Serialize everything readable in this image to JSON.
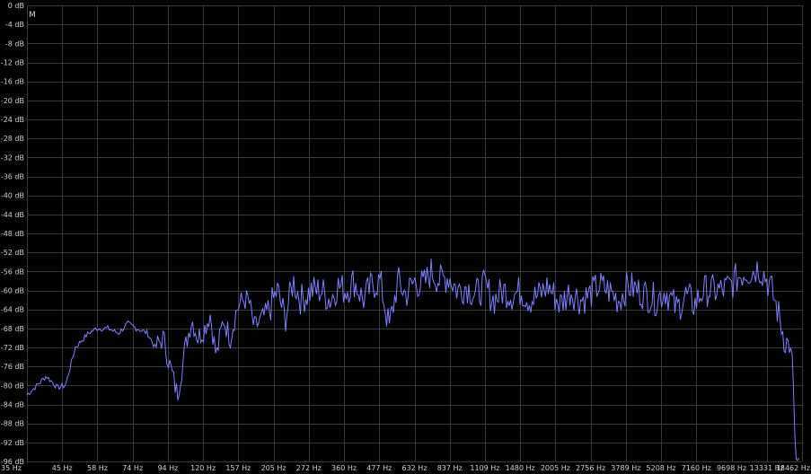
{
  "mode_label": "M",
  "colors": {
    "background": "#000000",
    "grid": "#3a3a3a",
    "text": "#cfcfcf",
    "trace": "#8080ff"
  },
  "chart_data": {
    "type": "line",
    "xscale": "log",
    "xlim": [
      35,
      20000
    ],
    "ylim": [
      -96,
      0
    ],
    "grid": true,
    "y_ticks": [
      "0 dB",
      "-4 dB",
      "-8 dB",
      "-12 dB",
      "-16 dB",
      "-20 dB",
      "-24 dB",
      "-28 dB",
      "-32 dB",
      "-36 dB",
      "-40 dB",
      "-44 dB",
      "-48 dB",
      "-52 dB",
      "-56 dB",
      "-60 dB",
      "-64 dB",
      "-68 dB",
      "-72 dB",
      "-76 dB",
      "-80 dB",
      "-84 dB",
      "-88 dB",
      "-92 dB",
      "-96 dB"
    ],
    "x_ticks": [
      "35 Hz",
      "45 Hz",
      "58 Hz",
      "74 Hz",
      "94 Hz",
      "120 Hz",
      "157 Hz",
      "205 Hz",
      "272 Hz",
      "360 Hz",
      "477 Hz",
      "632 Hz",
      "837 Hz",
      "1109 Hz",
      "1480 Hz",
      "2005 Hz",
      "2756 Hz",
      "3789 Hz",
      "5208 Hz",
      "7160 Hz",
      "9698 Hz",
      "13331 Hz",
      "18462 Hz"
    ],
    "series": [
      {
        "x": [
          35,
          38,
          41,
          45,
          48,
          52,
          58,
          62,
          68,
          74,
          80,
          86,
          94,
          100,
          107,
          112,
          120,
          128,
          135,
          142,
          150,
          157,
          165,
          175,
          185,
          195,
          205,
          215,
          225,
          240,
          255,
          272,
          290,
          310,
          330,
          360,
          390,
          420,
          445,
          477,
          510,
          550,
          590,
          632,
          680,
          730,
          780,
          837,
          900,
          960,
          1030,
          1109,
          1190,
          1280,
          1380,
          1480,
          1600,
          1740,
          1870,
          2005,
          2150,
          2320,
          2500,
          2756,
          3000,
          3260,
          3500,
          3789,
          4100,
          4450,
          4800,
          5208,
          5600,
          6050,
          6550,
          7160,
          7700,
          8300,
          8900,
          9698,
          10400,
          11100,
          11900,
          12600,
          13331,
          14000,
          14800,
          15600,
          16500,
          17300,
          18000,
          18462,
          19000,
          19500
        ],
        "y": [
          -82,
          -80,
          -78,
          -80.5,
          -80,
          -72,
          -69,
          -68,
          -68,
          -69,
          -67,
          -68,
          -69,
          -72,
          -70,
          -75,
          -82,
          -72,
          -66,
          -70,
          -68,
          -65,
          -74,
          -66,
          -70,
          -64,
          -62,
          -62,
          -68,
          -66,
          -64,
          -60,
          -66,
          -58,
          -62,
          -60,
          -60,
          -62,
          -59,
          -60,
          -58,
          -62,
          -59,
          -58,
          -68,
          -58,
          -61,
          -58,
          -59,
          -56,
          -58,
          -57,
          -60,
          -59,
          -61,
          -59,
          -62,
          -60,
          -61,
          -60,
          -62,
          -61,
          -59,
          -63,
          -60,
          -62,
          -61,
          -59,
          -60,
          -62,
          -59,
          -60,
          -61,
          -62,
          -60,
          -64,
          -61,
          -63,
          -60,
          -60,
          -60,
          -59,
          -57,
          -56,
          -56,
          -55,
          -57,
          -60,
          -65,
          -70,
          -72,
          -74,
          -96,
          -96
        ]
      }
    ]
  }
}
